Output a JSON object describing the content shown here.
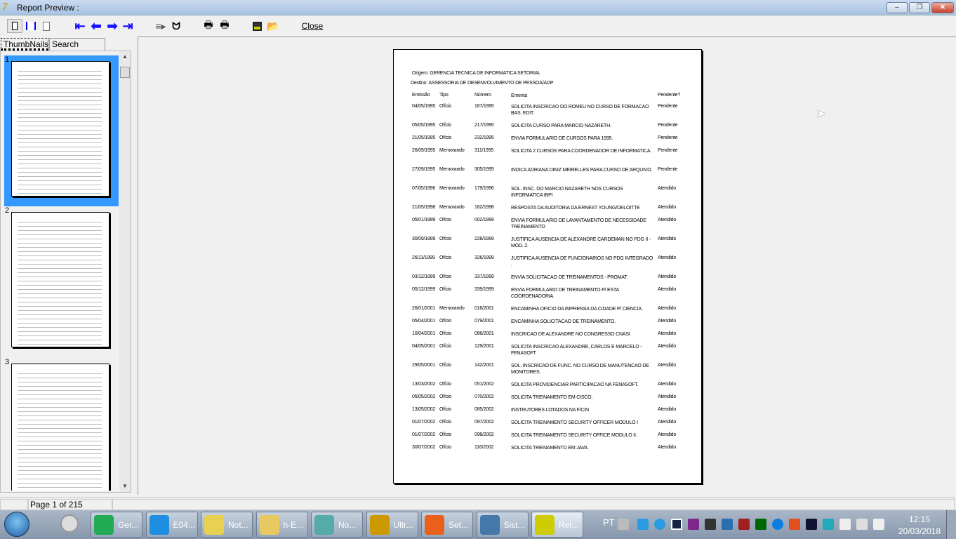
{
  "window": {
    "title": "Report Preview :",
    "minimize": "‒",
    "maximize": "❐",
    "close": "✕"
  },
  "toolbar": {
    "close_label": "Close"
  },
  "tabs": [
    {
      "label": "ThumbNails"
    },
    {
      "label": "Search Results"
    }
  ],
  "thumbnails": [
    {
      "num": "1"
    },
    {
      "num": "2"
    },
    {
      "num": "3"
    }
  ],
  "report": {
    "origem": "Origem: GERENCIA TECNICA DE INFORMATICA SETORIAL",
    "destino": "Destino: ASSESSORIA DE DESENVOLVIMENTO DE PESSOA/ADP",
    "columns": [
      "Emissão",
      "Tipo",
      "Número",
      "Ementa",
      "Pendente?"
    ],
    "rows": [
      [
        "04/05/1995",
        "Ofício",
        "167/1995",
        "SOLICITA INSCRICAO DO ROMEU NO CURSO DE FORMACAO BAS. EDIT.",
        "Pendente"
      ],
      [
        "05/05/1995",
        "Ofício",
        "217/1995",
        "SOLICITA CURSO PARA MARCIO NAZARETH.",
        "Pendente"
      ],
      [
        "21/05/1995",
        "Ofício",
        "232/1995",
        "ENVIA FORMULARIO DE CURSOS PARA 1995.",
        "Pendente"
      ],
      [
        "26/09/1995",
        "Memorando",
        "311/1995",
        "SOLICITA 2 CURSOS PARA COORDENADOR DE INFORMATICA.",
        "Pendente"
      ],
      [
        "27/09/1995",
        "Memorando",
        "305/1995",
        "INDICA ADRIANA DINIZ MEIRELLES PARA CURSO DE ARQUIVO.",
        "Pendente"
      ],
      [
        "07/05/1996",
        "Memorando",
        "179/1996",
        "SOL. INSC. DO MARCIO NAZARETH NOS CURSOS INFORMATICA IBPI",
        "Atendido"
      ],
      [
        "21/05/1998",
        "Memorando",
        "162/1998",
        "RESPOSTA DA AUDITORIA DA ERNEST YOUNG/DELOITTE",
        "Atendido"
      ],
      [
        "05/01/1999",
        "Ofício",
        "002/1999",
        "ENVIA FORMULARIO DE LAVANTAMENTO DE NECESSIDADE TREINAMENTO",
        "Atendido"
      ],
      [
        "30/09/1999",
        "Ofício",
        "228/1999",
        "JUSTIFICA AUSENCIA DE ALEXANDRE CARDEMAN NO PDG II - MOD. 2.",
        "Atendido"
      ],
      [
        "26/11/1999",
        "Ofício",
        "326/1999",
        "JUSTIFICA AUSENCIA DE FUNCIONARIOS NO PDG INTEGRADO .",
        "Atendido"
      ],
      [
        "03/12/1999",
        "Ofício",
        "337/1999",
        "ENVIA SOLICITACAO DE TREINAMENTOS - PROMAT.",
        "Atendido"
      ],
      [
        "05/12/1999",
        "Ofício",
        "339/1999",
        "ENVIA FORMULARIO DE TREINAMENTO P/ ESTA COORDENADORIA.",
        "Atendido"
      ],
      [
        "26/01/2001",
        "Memorando",
        "016/2001",
        "ENCAMINHA OFICIO DA IMPRENSA DA CIDADE P/ CIENCIA.",
        "Atendido"
      ],
      [
        "05/04/2001",
        "Ofício",
        "079/2001",
        "ENCAMINHA SOLICITACAO DE TREINAMENTO.",
        "Atendido"
      ],
      [
        "10/04/2001",
        "Ofício",
        "086/2001",
        "INSCRICAO DE  ALEXANDRE NO CONGRESSO CNASI",
        "Atendido"
      ],
      [
        "04/05/2001",
        "Ofício",
        "129/2001",
        "SOLICITA INSCRICAO ALEXANDRE, CARLOS E MARCELO - FENASOFT",
        "Atendido"
      ],
      [
        "29/05/2001",
        "Ofício",
        "142/2001",
        "SOL. INSCRICAO DE FUNC. NO CURSO DE MANUTENCAO DE MONITORES.",
        "Atendido"
      ],
      [
        "13/03/2002",
        "Ofício",
        "051/2002",
        "SOLICITA PROVIDENCIAR PARTICIPACAO NA FENASOFT.",
        "Atendido"
      ],
      [
        "05/05/2002",
        "Ofício",
        "070/2002",
        "SOLICITA TREINAMENTO EM CISCO.",
        "Atendido"
      ],
      [
        "13/05/2002",
        "Ofício",
        "085/2002",
        "INSTRUTORES LOTADOS  NA F/CIN",
        "Atendido"
      ],
      [
        "01/07/2002",
        "Ofício",
        "097/2002",
        "SOLICITA TREINAMENTO SECURITY OFFICER MODULO I",
        "Atendido"
      ],
      [
        "01/07/2002",
        "Ofício",
        "098/2002",
        "SOLICITA TREINAMENTO SECURITY OFFICE MODULO II.",
        "Atendido"
      ],
      [
        "30/07/2002",
        "Ofício",
        "116/2002",
        "SOLICITA TREINAMENTO EM JAVA.",
        "Atendido"
      ]
    ],
    "two_line_rows": [
      0,
      3,
      4,
      5,
      7,
      8,
      9,
      11,
      15,
      16
    ]
  },
  "status": {
    "page": "Page 1 of 215"
  },
  "taskbar": {
    "items": [
      {
        "label": "Ger...",
        "icon": "monitor-app-icon",
        "color": "#2a5"
      },
      {
        "label": "E04...",
        "icon": "internet-explorer-icon",
        "color": "#1e8fe0"
      },
      {
        "label": "Not...",
        "icon": "sticky-notes-icon",
        "color": "#e8d050"
      },
      {
        "label": "h-E...",
        "icon": "folder-icon",
        "color": "#e8c860"
      },
      {
        "label": "No...",
        "icon": "app-icon",
        "color": "#5aa"
      },
      {
        "label": "Ultr...",
        "icon": "ultraedit-icon",
        "color": "#c90"
      },
      {
        "label": "Set...",
        "icon": "firefox-icon",
        "color": "#e8601a"
      },
      {
        "label": "Sist...",
        "icon": "sail-app-icon",
        "color": "#47a"
      },
      {
        "label": "Rel...",
        "icon": "report-app-icon",
        "color": "#cc0"
      }
    ],
    "lang": "PT",
    "time": "12:15",
    "date": "20/03/2018"
  }
}
